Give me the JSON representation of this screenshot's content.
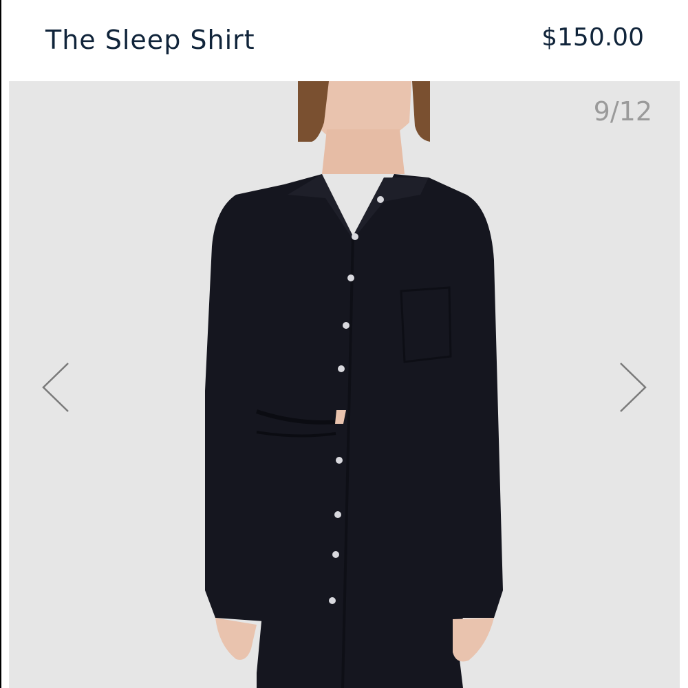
{
  "product": {
    "title": "The Sleep Shirt",
    "price": "$150.00"
  },
  "gallery": {
    "counter": "9/12",
    "prev_icon": "chevron-left-icon",
    "next_icon": "chevron-right-icon",
    "image_alt": "Model wearing black long-sleeve button-up sleep shirt with matching pants"
  },
  "colors": {
    "title_text": "#10243a",
    "counter_text": "#9a9a9a",
    "gallery_bg": "#e6e6e6",
    "shirt": "#15161f"
  }
}
